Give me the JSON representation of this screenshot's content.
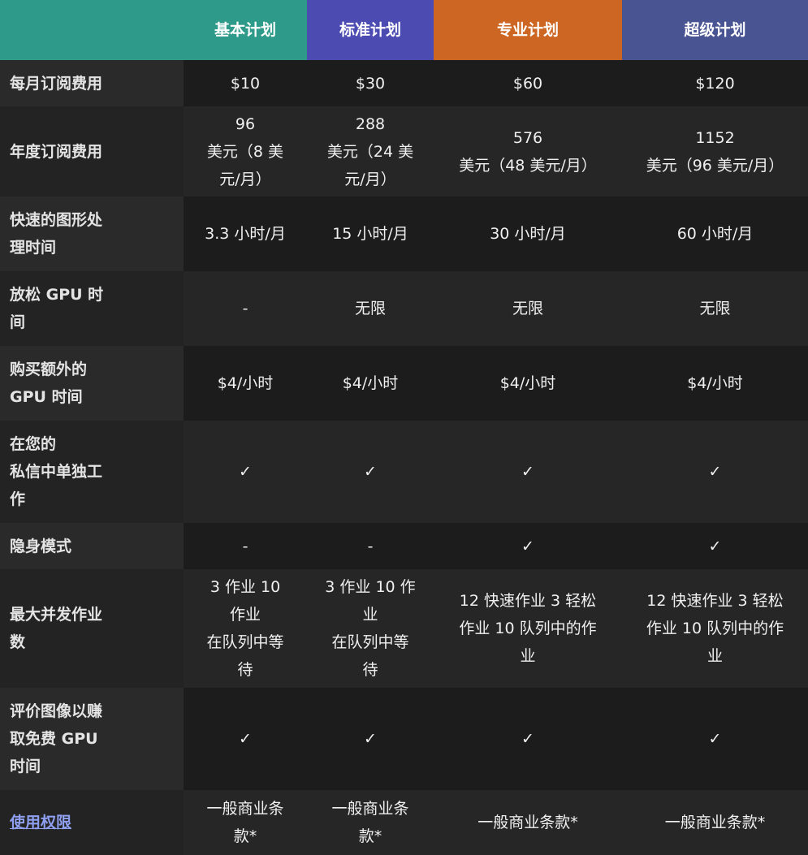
{
  "header": {
    "corner": "",
    "plans": [
      "基本计划",
      "标准计划",
      "专业计划",
      "超级计划"
    ],
    "colors": [
      "#2e9a89",
      "#4b4bb2",
      "#cd6622",
      "#495493"
    ]
  },
  "rows": [
    {
      "label": "每月订阅费用",
      "values": [
        "$10",
        "$30",
        "$60",
        "$120"
      ]
    },
    {
      "label": "年度订阅费用",
      "values": [
        "96\n美元（8 美\n元/月）",
        "288\n美元（24 美\n元/月）",
        "576\n美元（48 美元/月）",
        "1152\n美元（96 美元/月）"
      ]
    },
    {
      "label": "快速的图形处\n理时间",
      "values": [
        "3.3 小时/月",
        "15 小时/月",
        "30 小时/月",
        "60 小时/月"
      ]
    },
    {
      "label": "放松 GPU 时\n间",
      "values": [
        "-",
        "无限",
        "无限",
        "无限"
      ]
    },
    {
      "label": "购买额外的\nGPU 时间",
      "values": [
        "$4/小时",
        "$4/小时",
        "$4/小时",
        "$4/小时"
      ]
    },
    {
      "label": "在您的\n私信中单独工\n作",
      "values": [
        "✓",
        "✓",
        "✓",
        "✓"
      ]
    },
    {
      "label": "隐身模式",
      "values": [
        "-",
        "-",
        "✓",
        "✓"
      ]
    },
    {
      "label": "最大并发作业\n数",
      "values": [
        "3 作业 10\n作业\n在队列中等\n待",
        "3 作业 10 作\n业\n在队列中等\n待",
        "12 快速作业 3 轻松\n作业 10 队列中的作\n业",
        "12 快速作业 3 轻松\n作业 10 队列中的作\n业"
      ]
    },
    {
      "label": "评价图像以赚\n取免费 GPU\n时间",
      "values": [
        "✓",
        "✓",
        "✓",
        "✓"
      ]
    },
    {
      "label": "使用权限",
      "values": [
        "一般商业条\n款*",
        "一般商业条\n款*",
        "一般商业条款*",
        "一般商业条款*"
      ],
      "link": true
    }
  ]
}
